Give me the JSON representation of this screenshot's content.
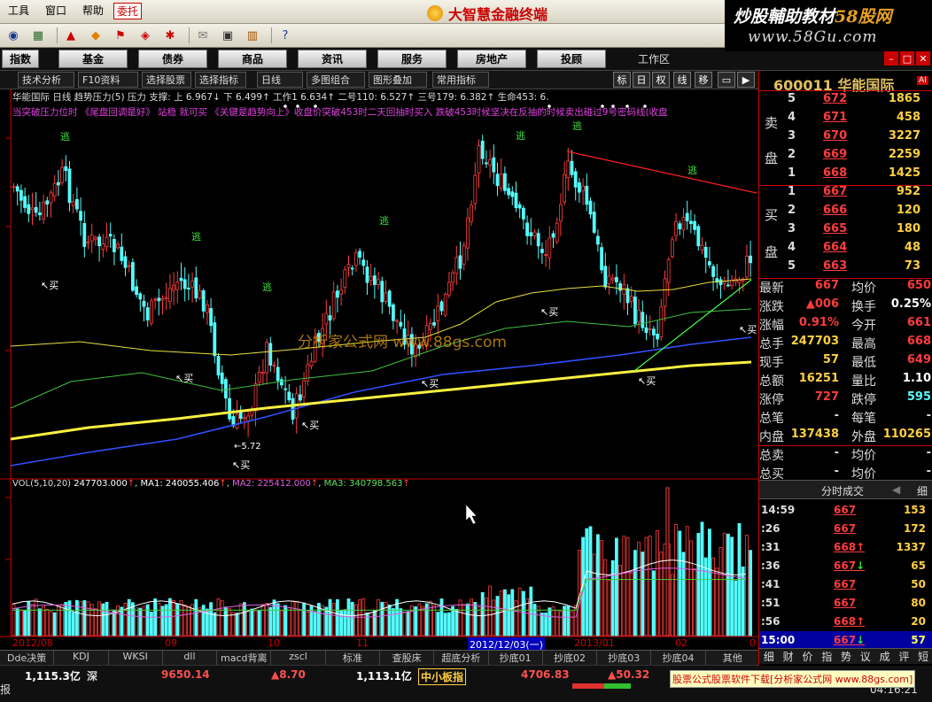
{
  "app": {
    "title": "大智慧金融终端",
    "menu": [
      "工具",
      "窗口",
      "帮助"
    ],
    "menu_highlight": "委托",
    "brand_main": "炒股輔助教材",
    "brand_main_accent": "58股网",
    "brand_sub": "www.58Gu.com"
  },
  "nav": {
    "items": [
      "指数",
      "基金",
      "债券",
      "商品",
      "资讯",
      "服务",
      "房地产",
      "投顾"
    ],
    "workarea": "工作区"
  },
  "tabs": {
    "items": [
      "技术分析",
      "F10资料",
      "选择股票",
      "选择指标",
      "日线",
      "多图组合",
      "图形叠加",
      "常用指标"
    ],
    "right": [
      "标",
      "日",
      "权",
      "线",
      "移"
    ]
  },
  "info": {
    "line1": "华能国际 日线  趋势压力(5) 压力  支撑: 上  6.967↓  下  6.499↑  工作1  6.634↑  二号110: 6.527↑  三号179: 6.382↑  生命453: 6.",
    "line2": "当突破压力位时 《尾盘回调是好》 站稳 就可买 《关键是趋势向上》收盘价突破453时二天回抽时买入 跌破453时候坚决在反抽的时候卖出碰过9号密码线(收盘"
  },
  "annotations": {
    "escape": "逃",
    "buy": "买",
    "low_label": "5.72"
  },
  "watermark": "分析家公式网 www.88gs.com",
  "vol": {
    "label": "VOL(5,10,20)",
    "value": "247703.000",
    "ma1": "MA1: 240055.406",
    "ma2": "MA2: 225412.000",
    "ma3": "MA3: 340798.563"
  },
  "xaxis": [
    "2012/08",
    "09",
    "10",
    "11",
    "2012/12/03(一)",
    "2013/01",
    "02",
    "0"
  ],
  "bottom_tabs": [
    "Dde决策",
    "KDJ",
    "WKSI",
    "dll",
    "macd背离",
    "zscl",
    "标准",
    "查股床",
    "超底分析",
    "抄底01",
    "抄底02",
    "抄底03",
    "抄底04",
    "其他"
  ],
  "status": {
    "sh_amount": "1,115.3亿",
    "sh_label": "深",
    "sz_index": "9650.14",
    "sz_change": "▲8.70",
    "sz_amount": "1,113.1亿",
    "board": "中小板指",
    "board_index": "4706.83",
    "board_change": "▲50.32",
    "time": "04:16:21",
    "left_label": "报"
  },
  "promo": "股票公式股票软件下载[分析家公式网 www.88gs.com]",
  "quote": {
    "code": "600011",
    "name": "华能国际",
    "ai": "AI",
    "sell_label": [
      "卖",
      "盘"
    ],
    "buy_label": [
      "买",
      "盘"
    ],
    "sell": [
      {
        "n": "5",
        "p": "672",
        "v": "1865"
      },
      {
        "n": "4",
        "p": "671",
        "v": "458"
      },
      {
        "n": "3",
        "p": "670",
        "v": "3227"
      },
      {
        "n": "2",
        "p": "669",
        "v": "2259"
      },
      {
        "n": "1",
        "p": "668",
        "v": "1425"
      }
    ],
    "buy": [
      {
        "n": "1",
        "p": "667",
        "v": "952"
      },
      {
        "n": "2",
        "p": "666",
        "v": "120"
      },
      {
        "n": "3",
        "p": "665",
        "v": "180"
      },
      {
        "n": "4",
        "p": "664",
        "v": "48"
      },
      {
        "n": "5",
        "p": "663",
        "v": "73"
      }
    ],
    "stats": [
      {
        "l": "最新",
        "v": "667",
        "l2": "均价",
        "v2": "650"
      },
      {
        "l": "涨跌",
        "v": "▲006",
        "l2": "换手",
        "v2": "0.25%"
      },
      {
        "l": "涨幅",
        "v": "0.91%",
        "l2": "今开",
        "v2": "661"
      },
      {
        "l": "总手",
        "v": "247703",
        "l2": "最高",
        "v2": "668"
      },
      {
        "l": "现手",
        "v": "57",
        "l2": "最低",
        "v2": "649"
      },
      {
        "l": "总额",
        "v": "16251",
        "l2": "量比",
        "v2": "1.10"
      },
      {
        "l": "涨停",
        "v": "727",
        "l2": "跌停",
        "v2": "595"
      },
      {
        "l": "总笔",
        "v": "-",
        "l2": "每笔",
        "v2": "-"
      },
      {
        "l": "内盘",
        "v": "137438",
        "l2": "外盘",
        "v2": "110265"
      },
      {
        "l": "总卖",
        "v": "-",
        "l2": "均价",
        "v2": "-"
      },
      {
        "l": "总买",
        "v": "-",
        "l2": "均价",
        "v2": "-"
      }
    ],
    "trade_header": "分时成交",
    "trade_header_right": "细",
    "trades": [
      {
        "t": "14:59",
        "p": "667",
        "v": "153"
      },
      {
        "t": ":26",
        "p": "667",
        "v": "172"
      },
      {
        "t": ":31",
        "p": "668↑",
        "v": "1337"
      },
      {
        "t": ":36",
        "p": "667↓",
        "v": "65"
      },
      {
        "t": ":41",
        "p": "667",
        "v": "50"
      },
      {
        "t": ":51",
        "p": "667",
        "v": "80"
      },
      {
        "t": ":56",
        "p": "668↑",
        "v": "20"
      },
      {
        "t": "15:00",
        "p": "667↓",
        "v": "57"
      }
    ],
    "side_tabs": [
      "细",
      "财",
      "价",
      "指",
      "势",
      "议",
      "成",
      "评",
      "短"
    ]
  },
  "colors": {
    "up": "#ff3c3c",
    "down": "#54fcfc",
    "ma_yellow": "#ffff40",
    "ma_green": "#40c040",
    "ma_blue": "#3050ff",
    "ma_gold": "#f0e040",
    "text_gray": "#c0c0c0",
    "label_gold": "#ffd040"
  }
}
